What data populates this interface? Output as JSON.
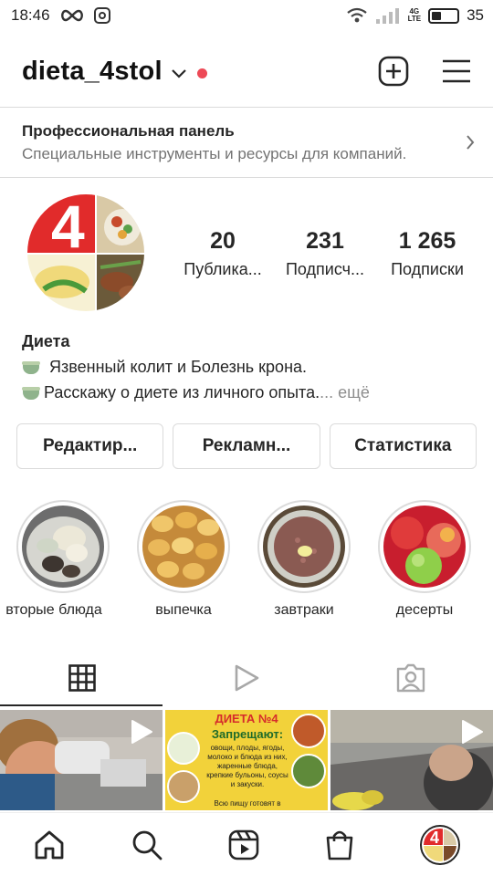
{
  "status_bar": {
    "time": "18:46",
    "network": "4G",
    "network_sub": "LTE",
    "battery": "35"
  },
  "header": {
    "username": "dieta_4stol"
  },
  "pro_panel": {
    "title": "Профессиональная панель",
    "subtitle": "Специальные инструменты и ресурсы для компаний."
  },
  "stats": [
    {
      "value": "20",
      "label": "Публика..."
    },
    {
      "value": "231",
      "label": "Подписч..."
    },
    {
      "value": "1 265",
      "label": "Подписки"
    }
  ],
  "bio": {
    "name": "Диета",
    "line1": "Язвенный колит и Болезнь крона.",
    "line2": "Расскажу о диете из личного опыта.",
    "more": "... ещё"
  },
  "buttons": {
    "edit": "Редактир...",
    "ads": "Рекламн...",
    "stats": "Статистика"
  },
  "highlights": [
    {
      "label": "вторые блюда"
    },
    {
      "label": "выпечка"
    },
    {
      "label": "завтраки"
    },
    {
      "label": "десерты"
    }
  ],
  "tabs": {
    "active": "grid"
  },
  "grid_poster": {
    "title": "ДИЕТА №4",
    "subtitle": "Запрещают:",
    "body": "овощи, плоды, ягоды, молоко и блюда из них, жаренные блюда, крепкие бульоны, соусы и закуски.",
    "footer": "Всю пищу готовят в"
  },
  "colors": {
    "accent_red": "#ed4956",
    "text": "#262626",
    "muted": "#737373",
    "border": "#dbdbdb",
    "poster_bg": "#f2d23a"
  },
  "icons": [
    "infinity-icon",
    "instagram-icon",
    "wifi-icon",
    "signal-icon",
    "battery-icon",
    "chevron-down-icon",
    "new-post-icon",
    "menu-icon",
    "chevron-right-icon",
    "grid-icon",
    "reels-icon",
    "tagged-icon",
    "play-icon",
    "home-icon",
    "search-icon",
    "reels-nav-icon",
    "shop-icon"
  ]
}
